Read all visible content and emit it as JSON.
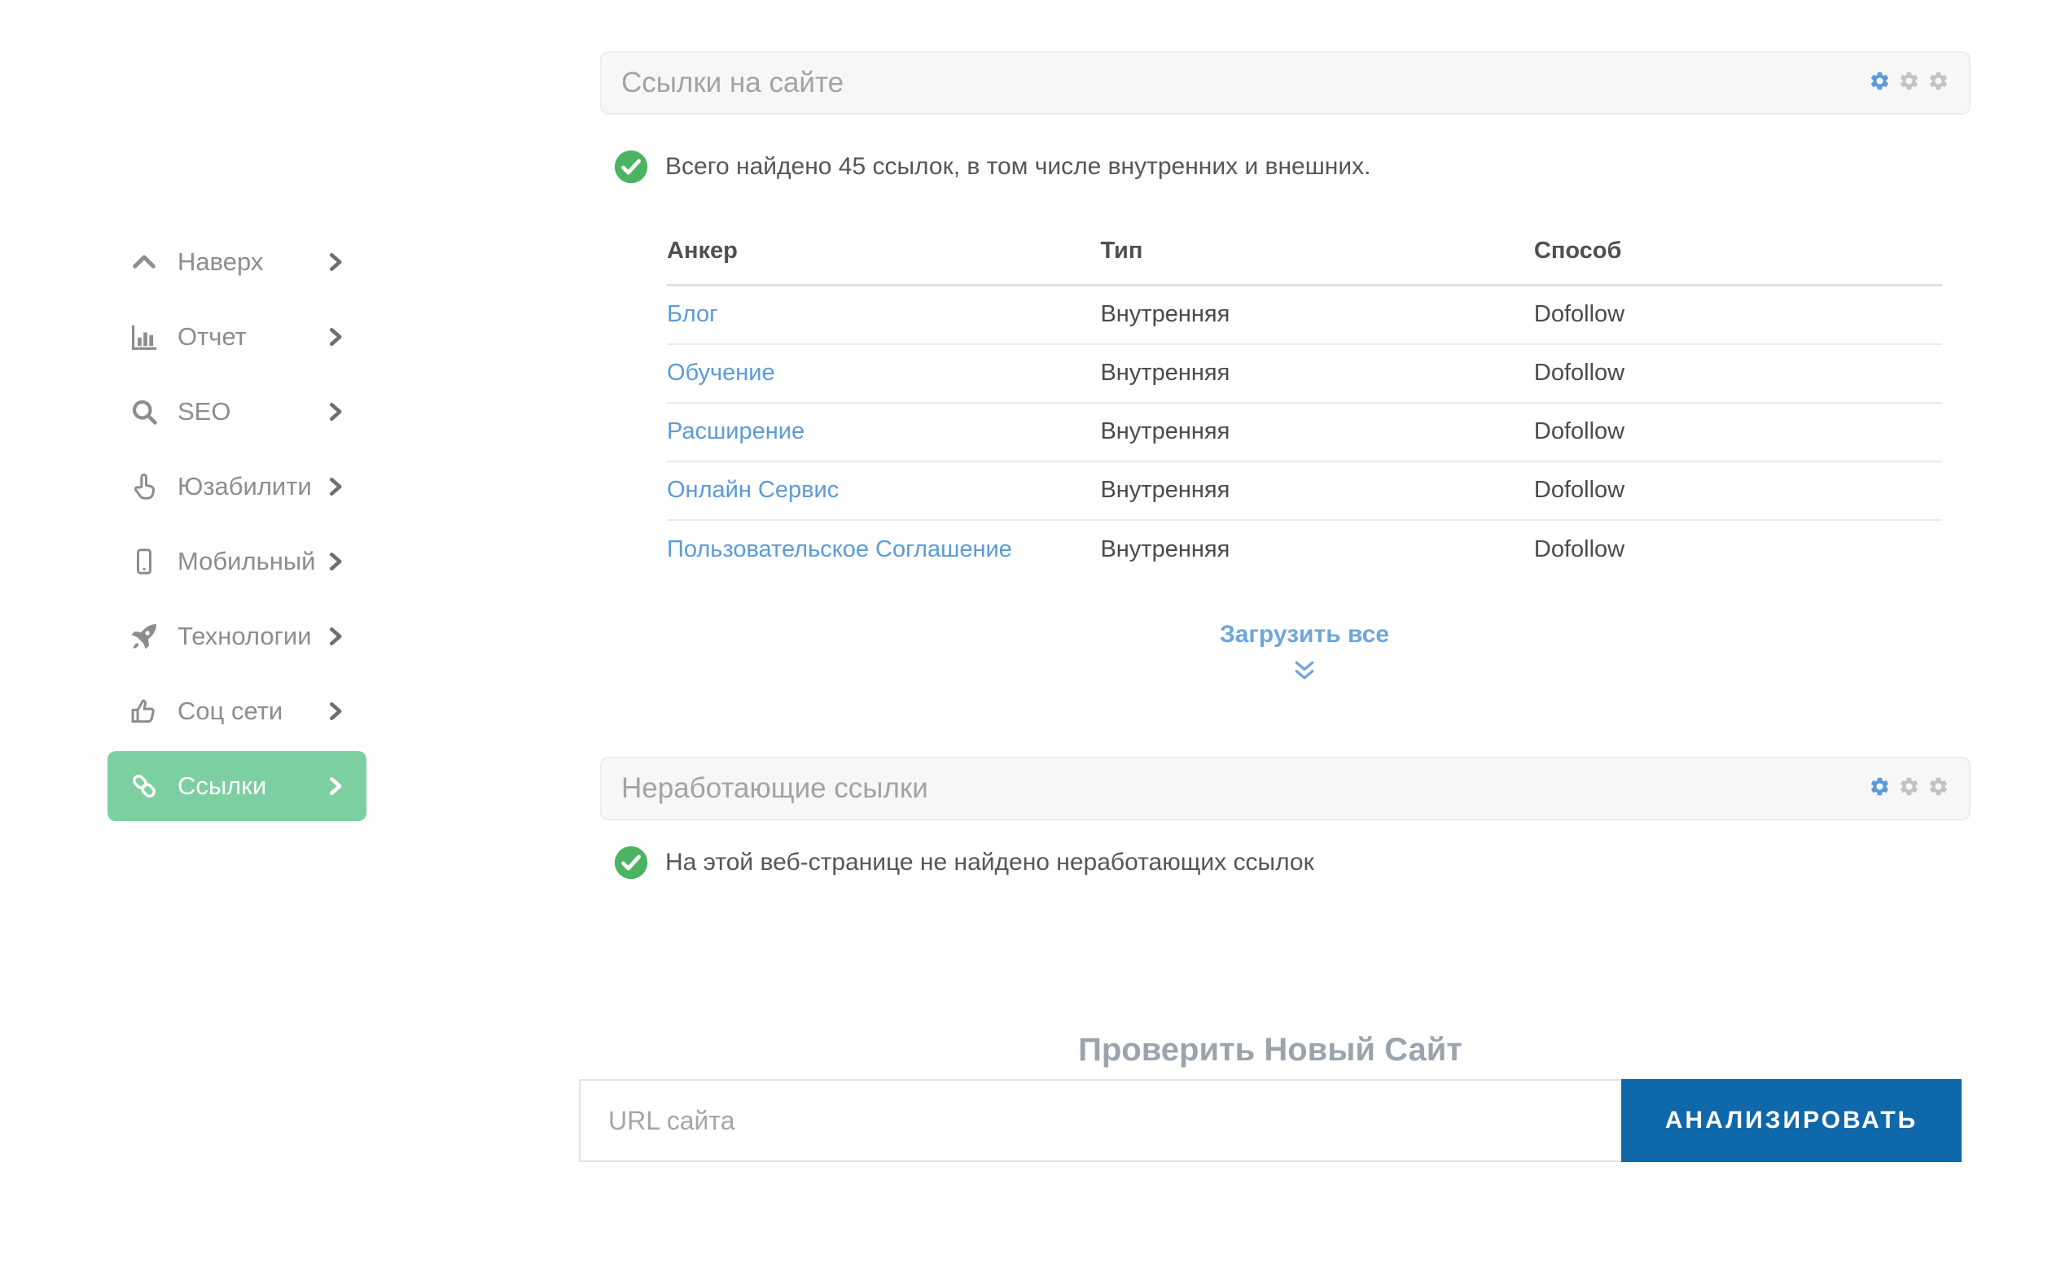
{
  "sidebar": {
    "items": [
      {
        "label": "Наверх",
        "icon": "chevron-up-icon"
      },
      {
        "label": "Отчет",
        "icon": "bar-chart-icon"
      },
      {
        "label": "SEO",
        "icon": "search-icon"
      },
      {
        "label": "Юзабилити",
        "icon": "hand-pointer-icon"
      },
      {
        "label": "Мобильный",
        "icon": "mobile-icon"
      },
      {
        "label": "Технологии",
        "icon": "rocket-icon"
      },
      {
        "label": "Соц сети",
        "icon": "thumbs-up-icon"
      },
      {
        "label": "Ссылки",
        "icon": "link-icon",
        "active": true
      }
    ]
  },
  "links_panel": {
    "title": "Ссылки на сайте",
    "status": "Всего найдено 45 ссылок, в том числе внутренних и внешних.",
    "table": {
      "headers": [
        "Анкер",
        "Тип",
        "Способ"
      ],
      "rows": [
        [
          "Блог",
          "Внутренняя",
          "Dofollow"
        ],
        [
          "Обучение",
          "Внутренняя",
          "Dofollow"
        ],
        [
          "Расширение",
          "Внутренняя",
          "Dofollow"
        ],
        [
          "Онлайн Сервис",
          "Внутренняя",
          "Dofollow"
        ],
        [
          "Пользовательское Соглашение",
          "Внутренняя",
          "Dofollow"
        ]
      ]
    },
    "load_all": "Загрузить все"
  },
  "broken_panel": {
    "title": "Неработающие ссылки",
    "status": "На этой веб-странице не найдено неработающих ссылок"
  },
  "new_site": {
    "heading": "Проверить Новый Сайт",
    "url_placeholder": "URL сайта",
    "analyze_button": "АНАЛИЗИРОВАТЬ"
  },
  "colors": {
    "active_sidebar_green": "#7ccfa0",
    "check_green": "#4bb462",
    "link_blue": "#5b9bd8",
    "gear_blue": "#5b9bd8",
    "gear_gray": "#c3c3c3",
    "load_all_blue": "#6ea6da",
    "analyze_button_blue": "#0f68a9",
    "panel_bg": "#f7f7f7",
    "heading_gray": "#9ba4ad"
  }
}
